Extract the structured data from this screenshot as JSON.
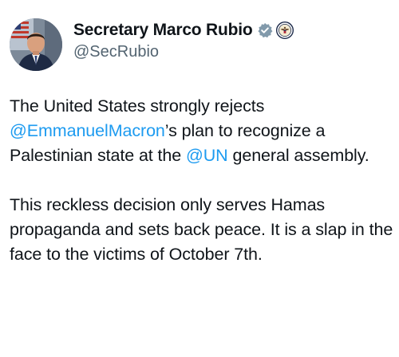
{
  "post": {
    "display_name": "Secretary Marco Rubio",
    "handle": "@SecRubio",
    "badges": [
      "verified-badge-icon",
      "government-seal-icon"
    ],
    "paragraph1": {
      "t1": "The United States strongly rejects ",
      "m1": "@EmmanuelMacron",
      "t2": "’s plan to recognize a Palestinian state at the ",
      "m2": "@UN",
      "t3": " general assembly."
    },
    "paragraph2": "This reckless decision only serves Hamas propaganda and sets back peace. It is a slap in the face to the victims of October 7th.",
    "colors": {
      "mention": "#1d9bf0",
      "handle": "#536471",
      "text": "#0f1419",
      "verified": "#829aab"
    }
  }
}
